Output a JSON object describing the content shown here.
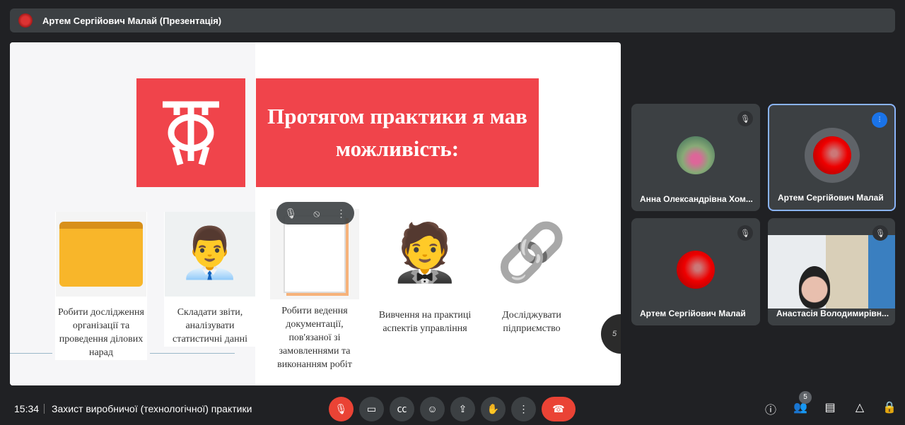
{
  "topbar": {
    "title": "Артем Сергійович Малай (Презентація)"
  },
  "slide": {
    "title": "Протягом практики я мав можливість:",
    "cards": [
      {
        "caption": "Робити дослідження організації та проведення ділових нарад"
      },
      {
        "caption": "Складати звіти, аналізувати статистичні данні"
      },
      {
        "caption": "Робити ведення документації, пов'язаної зі замовленнями та виконанням робіт"
      },
      {
        "caption": "Вивчення на практиці аспектів управління"
      },
      {
        "caption": "Досліджувати підприємство"
      }
    ],
    "fab_label": "5"
  },
  "participants": [
    {
      "name": "Анна Олександрівна Хом...",
      "muted": true
    },
    {
      "name": "Артем Сергійович Малай",
      "speaking": true
    },
    {
      "name": "Артем Сергійович Малай",
      "muted": true
    },
    {
      "name": "Анастасія Володимирівн...",
      "muted": true
    }
  ],
  "footer": {
    "time": "15:34",
    "meeting": "Захист виробничої (технологічної) практики",
    "people_count": "5"
  },
  "colors": {
    "accent": "#f0444b",
    "end": "#ea4335",
    "active": "#8ab4f8"
  }
}
